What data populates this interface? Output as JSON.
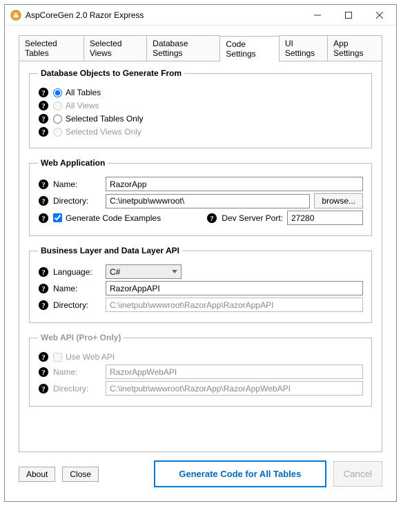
{
  "window": {
    "title": "AspCoreGen 2.0 Razor Express"
  },
  "tabs": {
    "items": [
      "Selected Tables",
      "Selected Views",
      "Database Settings",
      "Code Settings",
      "UI Settings",
      "App Settings"
    ],
    "activeIndex": 3
  },
  "dbObjects": {
    "legend": "Database Objects to Generate From",
    "options": [
      "All Tables",
      "All Views",
      "Selected Tables Only",
      "Selected Views Only"
    ],
    "enabled": [
      true,
      false,
      true,
      false
    ],
    "selected": 0
  },
  "webApp": {
    "legend": "Web Application",
    "nameLabel": "Name:",
    "name": "RazorApp",
    "dirLabel": "Directory:",
    "dir": "C:\\inetpub\\wwwroot\\",
    "browse": "browse...",
    "genExamplesLabel": "Generate Code Examples",
    "genExamplesChecked": true,
    "devPortLabel": "Dev Server Port:",
    "devPort": "27280"
  },
  "bizLayer": {
    "legend": "Business Layer and Data Layer API",
    "langLabel": "Language:",
    "lang": "C#",
    "nameLabel": "Name:",
    "name": "RazorAppAPI",
    "dirLabel": "Directory:",
    "dir": "C:\\inetpub\\wwwroot\\RazorApp\\RazorAppAPI"
  },
  "webApi": {
    "legend": "Web API (Pro+ Only)",
    "useLabel": "Use Web API",
    "nameLabel": "Name:",
    "name": "RazorAppWebAPI",
    "dirLabel": "Directory:",
    "dir": "C:\\inetpub\\wwwroot\\RazorApp\\RazorAppWebAPI"
  },
  "footer": {
    "about": "About",
    "close": "Close",
    "generate": "Generate Code for All Tables",
    "cancel": "Cancel"
  }
}
